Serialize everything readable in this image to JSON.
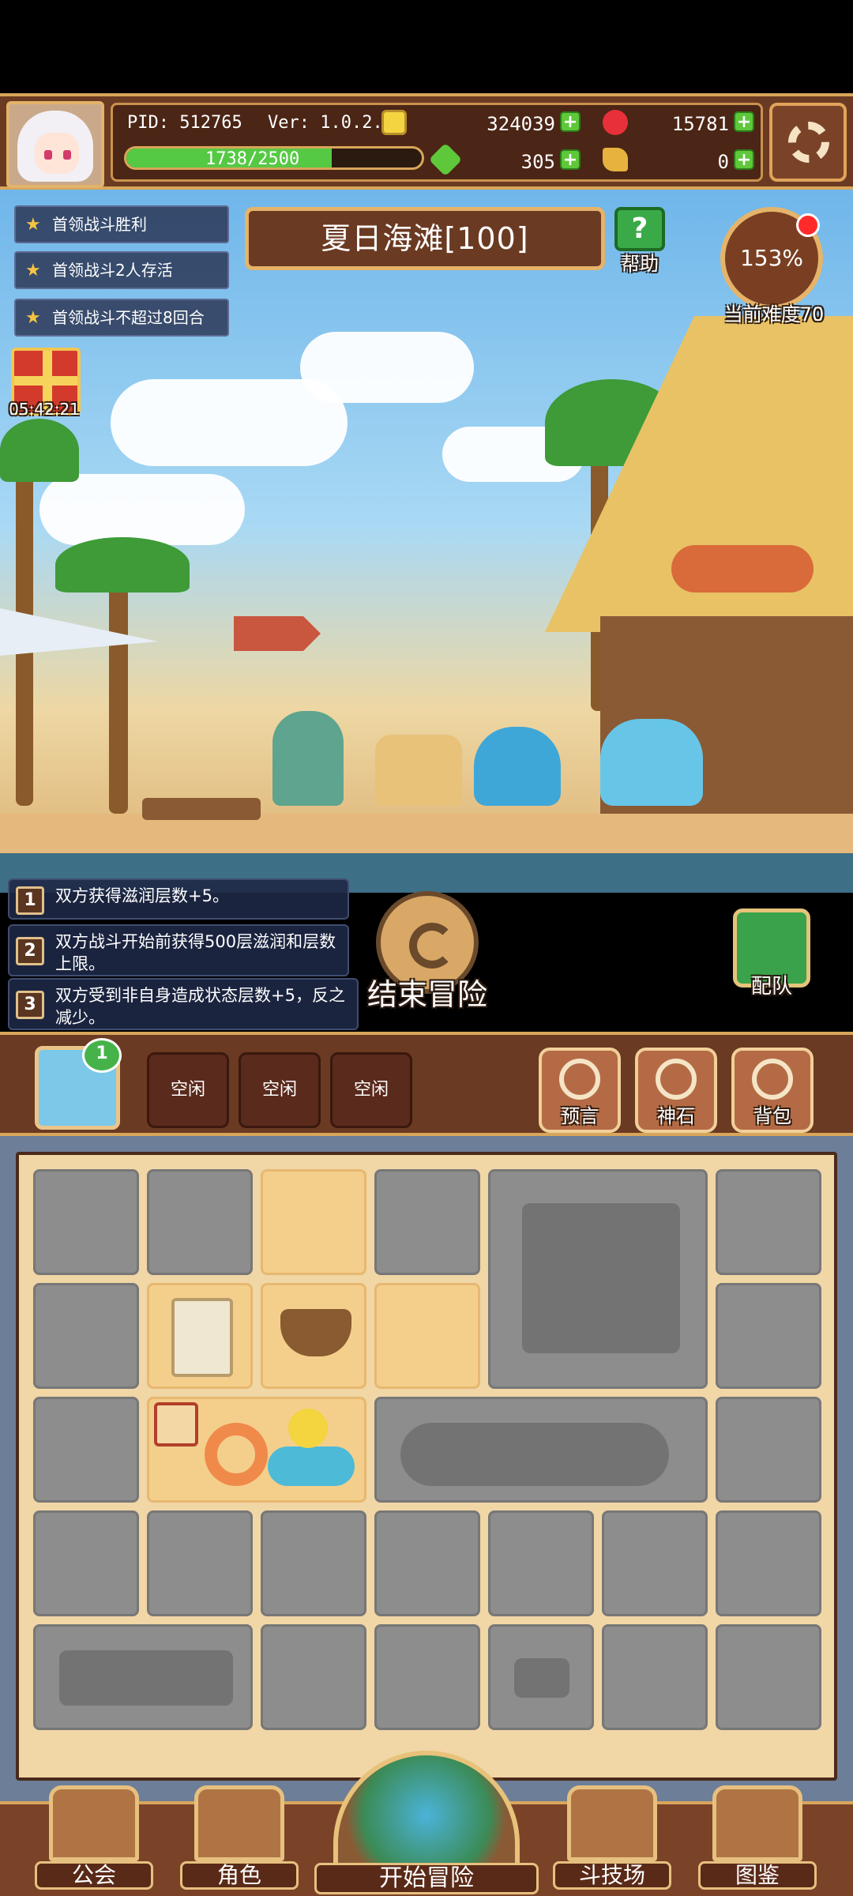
{
  "hud": {
    "pid": "PID: 512765",
    "version": "Ver: 1.0.2.6",
    "gold": "324039",
    "gems": "15781",
    "energy": "305",
    "keys": "0",
    "exp_text": "1738/2500",
    "exp_fraction": 0.6952
  },
  "stage": {
    "title": "夏日海滩[100]",
    "help_label": "帮助",
    "difficulty_percent": "153%",
    "difficulty_label": "当前难度70"
  },
  "quests": [
    "首领战斗胜利",
    "首领战斗2人存活",
    "首领战斗不超过8回合"
  ],
  "gift_timer": "05:42:21",
  "effects": [
    {
      "num": "1",
      "text": "双方获得滋润层数+5。"
    },
    {
      "num": "2",
      "text": "双方战斗开始前获得500层滋润和层数上限。"
    },
    {
      "num": "3",
      "text": "双方受到非自身造成状态层数+5，反之减少。"
    }
  ],
  "end_button_label": "结束冒险",
  "team_button_label": "配队",
  "midbar": {
    "map_badge": "1",
    "slots": [
      "空闲",
      "空闲",
      "空闲"
    ],
    "buttons": [
      "预言",
      "神石",
      "背包"
    ]
  },
  "nav": {
    "guild": "公会",
    "character": "角色",
    "start": "开始冒险",
    "arena": "斗技场",
    "codex": "图鉴"
  },
  "colors": {
    "wood": "#6b3a22",
    "gold_trim": "#d8a65a",
    "green": "#56c944"
  }
}
